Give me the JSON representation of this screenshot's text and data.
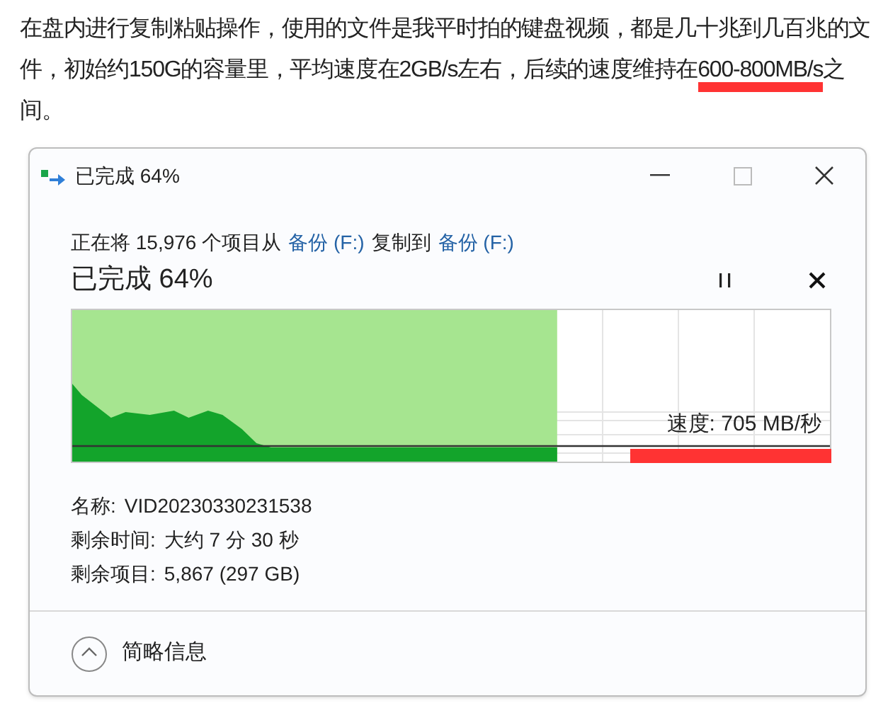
{
  "article": {
    "paragraph": {
      "before": "在盘内进行复制粘贴操作，使用的文件是我平时拍的键盘视频，都是几十兆到几百兆的文件，初始约150G的容量里，平均速度在2GB/s左右，后续的速度维持在",
      "highlighted": "600-800MB/s",
      "after": "之间。"
    }
  },
  "dialog": {
    "title": "已完成 64%",
    "description": {
      "prefix": "正在将 15,976 个项目从",
      "source": "备份 (F:)",
      "middle": "复制到",
      "destination": "备份 (F:)"
    },
    "progress_title": "已完成 64%",
    "progress": {
      "level": 0.64
    },
    "speed": "速度: 705 MB/秒",
    "details": [
      {
        "label": "名称:",
        "value": "VID20230330231538"
      },
      {
        "label": "剩余时间:",
        "value": "大约 7 分 30 秒"
      },
      {
        "label": "剩余项目:",
        "value": "5,867 (297 GB)"
      }
    ],
    "footer": {
      "label": "简略信息",
      "expanded": true
    }
  }
}
